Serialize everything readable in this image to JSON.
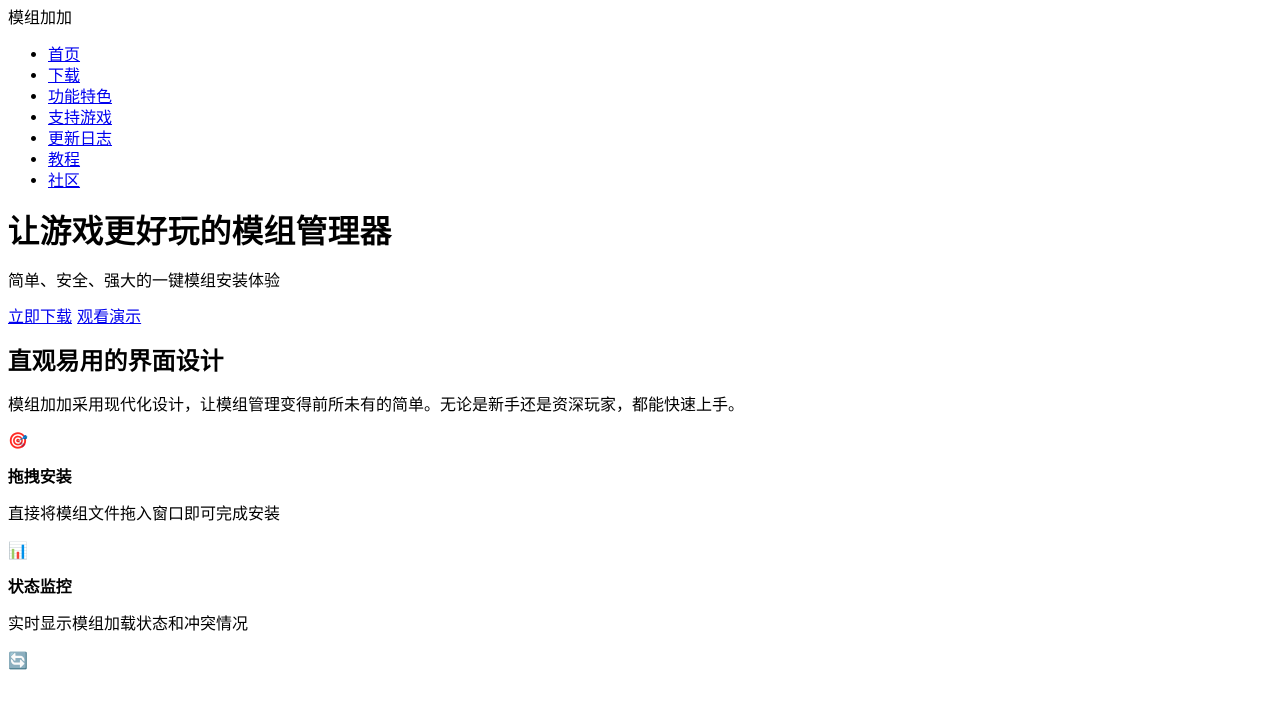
{
  "header": {
    "brand": "模组加加",
    "nav": [
      "首页",
      "下载",
      "功能特色",
      "支持游戏",
      "更新日志",
      "教程",
      "社区"
    ]
  },
  "hero": {
    "title": "让游戏更好玩的模组管理器",
    "subtitle": "简单、安全、强大的一键模组安装体验",
    "download_label": "立即下载",
    "demo_label": "观看演示"
  },
  "section": {
    "title": "直观易用的界面设计",
    "description": "模组加加采用现代化设计，让模组管理变得前所未有的简单。无论是新手还是资深玩家，都能快速上手。"
  },
  "features": [
    {
      "icon": "🎯",
      "icon_name": "target-icon",
      "title": "拖拽安装",
      "description": "直接将模组文件拖入窗口即可完成安装"
    },
    {
      "icon": "📊",
      "icon_name": "bar-chart-icon",
      "title": "状态监控",
      "description": "实时显示模组加载状态和冲突情况"
    },
    {
      "icon": "🔄",
      "icon_name": "refresh-icon"
    }
  ]
}
